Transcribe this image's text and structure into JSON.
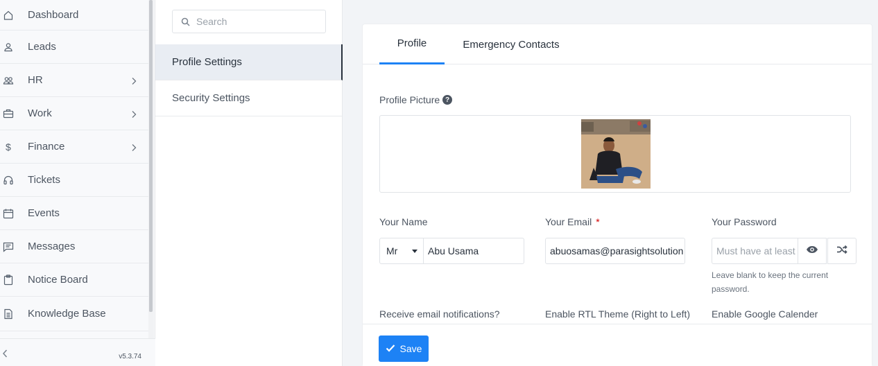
{
  "sidebar": {
    "items": [
      {
        "label": "Dashboard",
        "icon": "house-icon",
        "submenu": false
      },
      {
        "label": "Leads",
        "icon": "person-icon",
        "submenu": false
      },
      {
        "label": "HR",
        "icon": "people-icon",
        "submenu": true
      },
      {
        "label": "Work",
        "icon": "briefcase-icon",
        "submenu": true
      },
      {
        "label": "Finance",
        "icon": "dollar-icon",
        "submenu": true
      },
      {
        "label": "Tickets",
        "icon": "headset-icon",
        "submenu": false
      },
      {
        "label": "Events",
        "icon": "calendar-icon",
        "submenu": false
      },
      {
        "label": "Messages",
        "icon": "chat-icon",
        "submenu": false
      },
      {
        "label": "Notice Board",
        "icon": "clipboard-icon",
        "submenu": false
      },
      {
        "label": "Knowledge Base",
        "icon": "document-icon",
        "submenu": false
      }
    ],
    "version": "v5.3.74"
  },
  "settings_menu": {
    "search_placeholder": "Search",
    "items": [
      {
        "label": "Profile Settings",
        "active": true
      },
      {
        "label": "Security Settings",
        "active": false
      }
    ]
  },
  "tabs": [
    {
      "label": "Profile",
      "active": true
    },
    {
      "label": "Emergency Contacts",
      "active": false
    }
  ],
  "form": {
    "profile_picture_label": "Profile Picture",
    "help_glyph": "?",
    "name_label": "Your Name",
    "salutation": "Mr",
    "name_value": "Abu Usama",
    "email_label": "Your Email",
    "required_mark": "*",
    "email_value": "abuosamas@parasightsolution",
    "password_label": "Your Password",
    "password_placeholder": "Must have at least",
    "password_hint": "Leave blank to keep the current password.",
    "email_notifications_label": "Receive email notifications?",
    "rtl_label": "Enable RTL Theme (Right to Left)",
    "google_calendar_label": "Enable Google Calender"
  },
  "actions": {
    "save_label": "Save"
  },
  "colors": {
    "accent": "#1d82f5",
    "sidebar_bg": "#f8f9fb",
    "page_bg": "#f2f4f7",
    "active_menu_bg": "#e9edf3"
  }
}
